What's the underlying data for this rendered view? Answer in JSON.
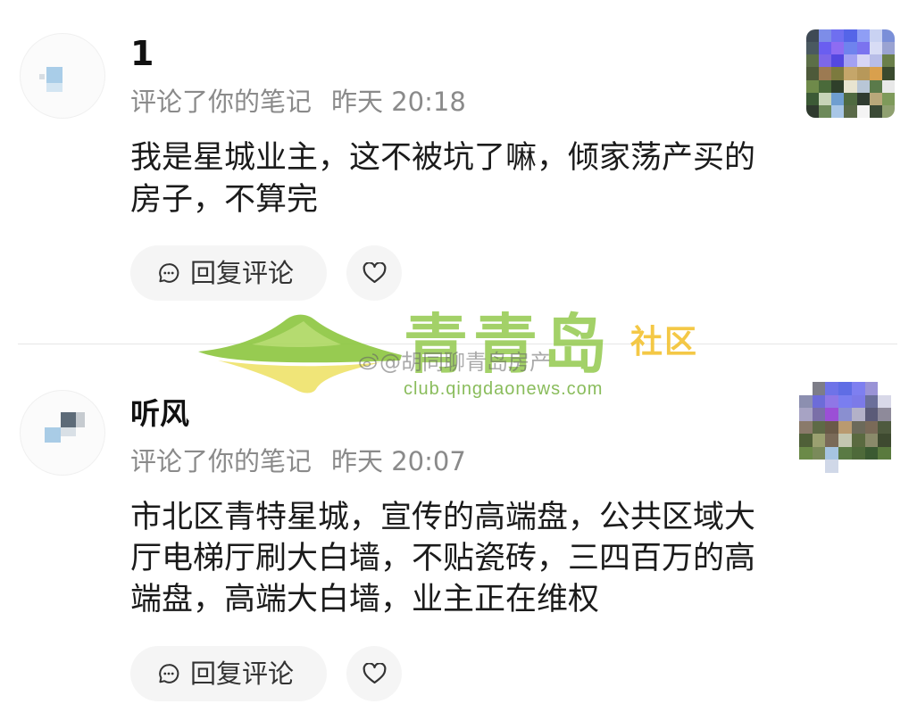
{
  "comments": [
    {
      "username": "1",
      "action": "评论了你的笔记",
      "time": "昨天 20:18",
      "text": "我是星城业主，这不被坑了嘛，倾家荡产买的房子，不算完",
      "reply_label": "回复评论",
      "reply_icon": "chat-bubble-icon",
      "like_icon": "heart-icon"
    },
    {
      "username": "听风",
      "action": "评论了你的笔记",
      "time": "昨天 20:07",
      "text": "市北区青特星城，宣传的高端盘，公共区域大厅电梯厅刷大白墙，不贴瓷砖，三四百万的高端盘，高端大白墙，业主正在维权",
      "reply_label": "回复评论",
      "reply_icon": "chat-bubble-icon",
      "like_icon": "heart-icon"
    }
  ],
  "watermark": {
    "brand": "青青岛",
    "section": "社区",
    "url": "club.qingdaonews.com",
    "handle": "@胡同聊青岛房产",
    "handle_icon": "weibo-icon",
    "logo_icon": "mountain-logo-icon"
  },
  "colors": {
    "button_bg": "#f5f5f5",
    "meta_text": "#8a8a8a",
    "watermark_green": "#93c94e",
    "watermark_yellow": "#f3c332"
  }
}
